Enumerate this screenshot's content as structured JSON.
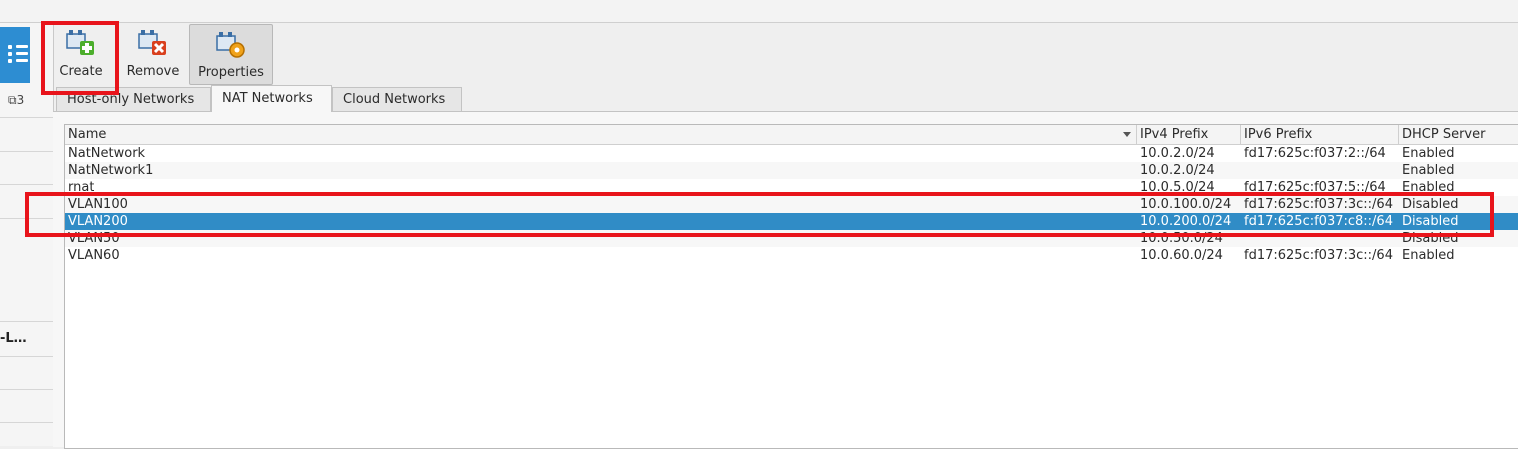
{
  "left_panel": {
    "count": "3",
    "truncated_label": "-L…"
  },
  "toolbar": {
    "create_label": "Create",
    "remove_label": "Remove",
    "properties_label": "Properties"
  },
  "tabs": [
    {
      "label": "Host-only Networks"
    },
    {
      "label": "NAT Networks"
    },
    {
      "label": "Cloud Networks"
    }
  ],
  "table": {
    "columns": [
      "Name",
      "IPv4 Prefix",
      "IPv6 Prefix",
      "DHCP Server"
    ],
    "rows": [
      {
        "name": "NatNetwork",
        "ipv4": "10.0.2.0/24",
        "ipv6": "fd17:625c:f037:2::/64",
        "dhcp": "Enabled"
      },
      {
        "name": "NatNetwork1",
        "ipv4": "10.0.2.0/24",
        "ipv6": "",
        "dhcp": "Enabled"
      },
      {
        "name": "rnat",
        "ipv4": "10.0.5.0/24",
        "ipv6": "fd17:625c:f037:5::/64",
        "dhcp": "Enabled"
      },
      {
        "name": "VLAN100",
        "ipv4": "10.0.100.0/24",
        "ipv6": "fd17:625c:f037:3c::/64",
        "dhcp": "Disabled"
      },
      {
        "name": "VLAN200",
        "ipv4": "10.0.200.0/24",
        "ipv6": "fd17:625c:f037:c8::/64",
        "dhcp": "Disabled"
      },
      {
        "name": "VLAN50",
        "ipv4": "10.0.50.0/24",
        "ipv6": "",
        "dhcp": "Disabled"
      },
      {
        "name": "VLAN60",
        "ipv4": "10.0.60.0/24",
        "ipv6": "fd17:625c:f037:3c::/64",
        "dhcp": "Enabled"
      }
    ],
    "selected_row": "VLAN200"
  },
  "colors": {
    "selection": "#308cc6",
    "highlight_box": "#e8141b",
    "accent": "#2d8dd2"
  }
}
